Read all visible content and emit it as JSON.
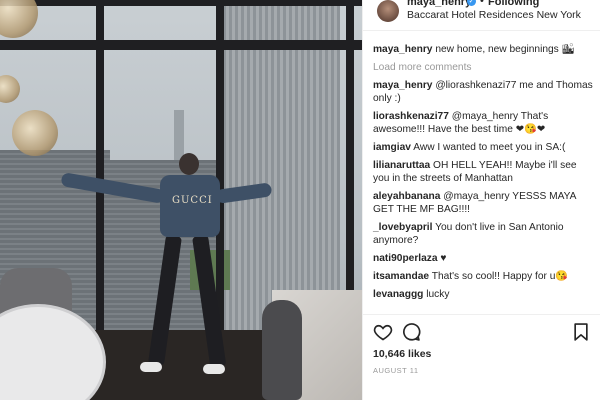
{
  "header": {
    "username": "maya_henry",
    "separator": "•",
    "follow_label": "Following",
    "location": "Baccarat Hotel Residences New York"
  },
  "caption": {
    "username": "maya_henry",
    "text": "new home, new beginnings 🏙"
  },
  "load_more_label": "Load more comments",
  "comments": [
    {
      "user": "maya_henry",
      "text": "@liorashkenazi77 me and Thomas only :)"
    },
    {
      "user": "liorashkenazi77",
      "text": "@maya_henry That's awesome!!! Have the best time ❤😘❤"
    },
    {
      "user": "iamgiav",
      "text": "Aww I wanted to meet you in SA:("
    },
    {
      "user": "lilianaruttaa",
      "text": "OH HELL YEAH!! Maybe i'll see you in the streets of Manhattan"
    },
    {
      "user": "aleyahbanana",
      "text": "@maya_henry YESSS MAYA GET THE MF BAG!!!!"
    },
    {
      "user": "_lovebyapril",
      "text": "You don't live in San Antonio anymore?"
    },
    {
      "user": "nati90perlaza",
      "text": "♥"
    },
    {
      "user": "itsamandae",
      "text": "That's so cool!! Happy for u😘"
    },
    {
      "user": "levanaggg",
      "text": "lucky"
    }
  ],
  "photo": {
    "jacket_text": "GUCCI"
  },
  "likes_text": "10,646 likes",
  "date_text": "AUGUST 11",
  "icons": [
    "heart-icon",
    "comment-icon",
    "bookmark-icon",
    "verified-badge-icon"
  ],
  "colors": {
    "verified": "#3897f0",
    "text": "#262626",
    "muted": "#999999"
  }
}
